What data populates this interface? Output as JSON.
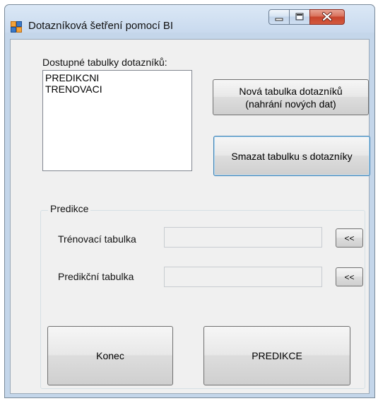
{
  "window": {
    "title": "Dotazníková šetření pomocí BI"
  },
  "tables_panel": {
    "label": "Dostupné tabulky dotazníků:",
    "items": [
      "PREDIKCNI",
      "TRENOVACI"
    ]
  },
  "buttons": {
    "new_table_line1": "Nová tabulka dotazníků",
    "new_table_line2": "(nahrání nových dat)",
    "delete_table": "Smazat tabulku s dotazníky",
    "exit": "Konec",
    "predict": "PREDIKCE",
    "assign": "<<"
  },
  "prediction_group": {
    "legend": "Predikce",
    "training_label": "Trénovací tabulka",
    "training_value": "",
    "prediction_label": "Predikční tabulka",
    "prediction_value": ""
  },
  "colors": {
    "client_background": "#f0f0f0",
    "close_button": "#c7442c",
    "focus_border": "#3c7fb1"
  }
}
